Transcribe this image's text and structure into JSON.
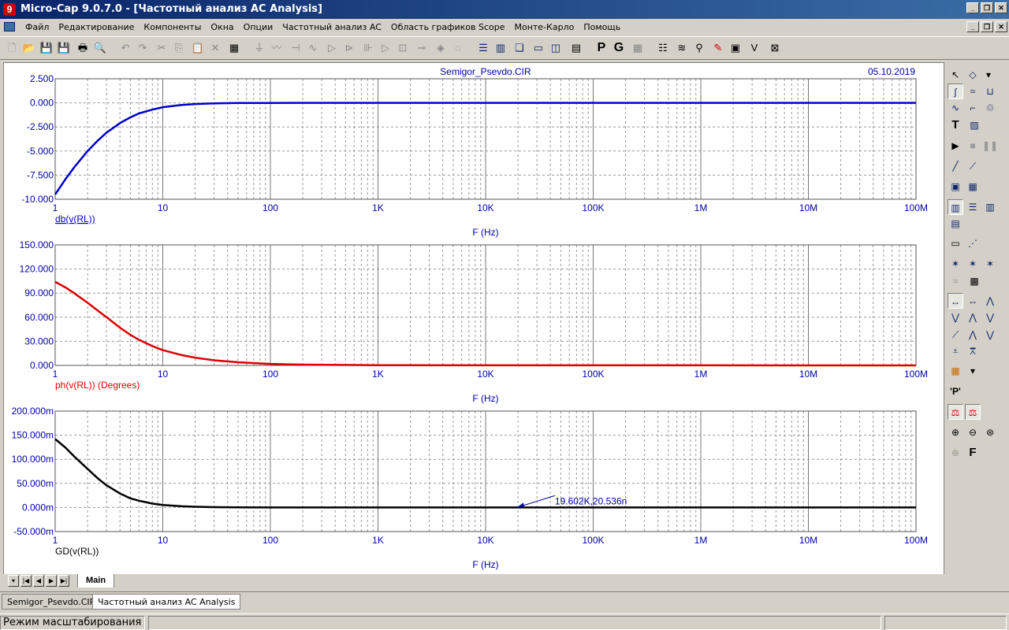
{
  "window": {
    "title": "Micro-Cap 9.0.7.0 - [Частотный анализ AC Analysis]"
  },
  "menu": [
    "Файл",
    "Редактирование",
    "Компоненты",
    "Окна",
    "Опции",
    "Частотный анализ AC",
    "Область графиков Scope",
    "Монте-Карло",
    "Помощь"
  ],
  "toolbar": {
    "label_p": "P",
    "label_g": "G"
  },
  "plot_header": {
    "filename": "Semigor_Psevdo.CIR",
    "date": "05.10.2019"
  },
  "annotation": {
    "text": "19.602K,20.536n"
  },
  "tabs": {
    "main": "Main"
  },
  "doc_tabs": [
    "Semigor_Psevdo.CIR",
    "Частотный анализ AC Analysis"
  ],
  "status": {
    "mode": "Режим масштабирования"
  },
  "chart_data": [
    {
      "type": "line",
      "xscale": "log",
      "xlim": [
        1,
        100000000
      ],
      "xticks": [
        "1",
        "10",
        "100",
        "1K",
        "10K",
        "100K",
        "1M",
        "10M",
        "100M"
      ],
      "xlabel": "F (Hz)",
      "ylabel": "db(v(RL))",
      "ylim": [
        -10,
        2.5
      ],
      "yticks": [
        "2.500",
        "0.000",
        "-2.500",
        "-5.000",
        "-7.500",
        "-10.000"
      ],
      "color": "#0000cc",
      "grid": true,
      "series": [
        {
          "x": [
            1,
            1.25,
            1.5,
            2,
            2.5,
            3,
            4,
            5,
            6,
            8,
            10,
            15,
            20,
            30,
            50,
            100,
            1000,
            100000000
          ],
          "y": [
            -9.5,
            -7.9,
            -6.7,
            -5.0,
            -3.9,
            -3.1,
            -2.1,
            -1.5,
            -1.1,
            -0.7,
            -0.45,
            -0.21,
            -0.12,
            -0.05,
            -0.02,
            -0.005,
            0,
            0
          ]
        }
      ]
    },
    {
      "type": "line",
      "xscale": "log",
      "xlim": [
        1,
        100000000
      ],
      "xticks": [
        "1",
        "10",
        "100",
        "1K",
        "10K",
        "100K",
        "1M",
        "10M",
        "100M"
      ],
      "xlabel": "F (Hz)",
      "ylabel": "ph(v(RL)) (Degrees)",
      "ylim": [
        0,
        150
      ],
      "yticks": [
        "150.000",
        "120.000",
        "90.000",
        "60.000",
        "30.000",
        "0.000"
      ],
      "color": "#dd0000",
      "grid": true,
      "series": [
        {
          "x": [
            1,
            1.25,
            1.5,
            2,
            2.5,
            3,
            4,
            5,
            6,
            8,
            10,
            15,
            20,
            30,
            50,
            100,
            200,
            1000,
            100000000
          ],
          "y": [
            104,
            97,
            90,
            78,
            68,
            60,
            47,
            38,
            32,
            24,
            19,
            12.8,
            9.6,
            6.4,
            3.9,
            1.9,
            1.0,
            0.2,
            0
          ]
        }
      ]
    },
    {
      "type": "line",
      "xscale": "log",
      "xlim": [
        1,
        100000000
      ],
      "xticks": [
        "1",
        "10",
        "100",
        "1K",
        "10K",
        "100K",
        "1M",
        "10M",
        "100M"
      ],
      "xlabel": "F (Hz)",
      "ylabel": "GD(v(RL))",
      "ylim": [
        -50,
        200
      ],
      "yticks": [
        "200.000m",
        "150.000m",
        "100.000m",
        "50.000m",
        "0.000m",
        "-50.000m"
      ],
      "color": "#000000",
      "grid": true,
      "series": [
        {
          "x": [
            1,
            1.25,
            1.5,
            2,
            2.5,
            3,
            4,
            5,
            6,
            8,
            10,
            15,
            20,
            30,
            50,
            100,
            1000,
            100000000
          ],
          "y": [
            142,
            124,
            106,
            80,
            60,
            46,
            29,
            19,
            14,
            8,
            5.3,
            2.4,
            1.4,
            0.6,
            0.2,
            0.05,
            0,
            0
          ]
        }
      ],
      "annotation_point": [
        19602,
        2e-05
      ]
    }
  ]
}
